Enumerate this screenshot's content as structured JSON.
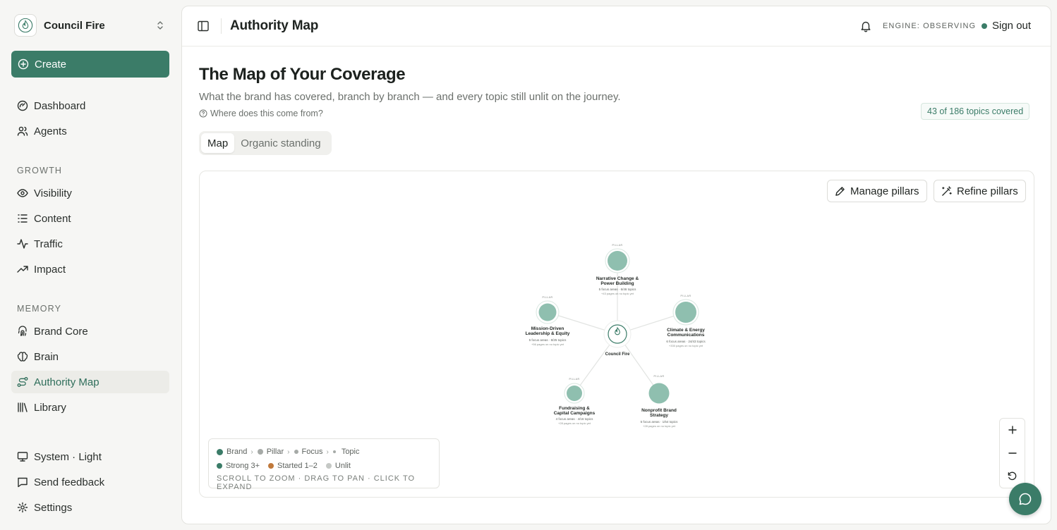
{
  "org": {
    "name": "Council Fire"
  },
  "sidebar": {
    "create_label": "Create",
    "top_items": [
      {
        "label": "Dashboard",
        "icon": "dashboard-icon"
      },
      {
        "label": "Agents",
        "icon": "users-icon"
      }
    ],
    "growth": {
      "title": "GROWTH",
      "items": [
        {
          "label": "Visibility",
          "icon": "eye-icon"
        },
        {
          "label": "Content",
          "icon": "list-icon"
        },
        {
          "label": "Traffic",
          "icon": "activity-icon"
        },
        {
          "label": "Impact",
          "icon": "trending-up-icon"
        }
      ]
    },
    "memory": {
      "title": "MEMORY",
      "items": [
        {
          "label": "Brand Core",
          "icon": "fingerprint-icon"
        },
        {
          "label": "Brain",
          "icon": "brain-icon"
        },
        {
          "label": "Authority Map",
          "icon": "route-icon",
          "active": true
        },
        {
          "label": "Library",
          "icon": "library-icon"
        }
      ]
    },
    "bottom_items": [
      {
        "label": "System · Light",
        "icon": "monitor-icon"
      },
      {
        "label": "Send feedback",
        "icon": "message-icon"
      },
      {
        "label": "Settings",
        "icon": "gear-icon"
      }
    ]
  },
  "header": {
    "title": "Authority Map",
    "engine_status": "ENGINE: OBSERVING",
    "sign_out": "Sign out"
  },
  "page": {
    "title": "The Map of Your Coverage",
    "subtitle": "What the brand has covered, branch by branch — and every topic still unlit on the journey.",
    "source_link": "Where does this come from?",
    "coverage_badge": "43 of 186 topics covered",
    "tabs": [
      "Map",
      "Organic standing"
    ],
    "active_tab": 0
  },
  "map": {
    "toolbar": {
      "manage_pillars": "Manage pillars",
      "refine_pillars": "Refine pillars"
    },
    "brand": {
      "label": "Council Fire"
    },
    "pillars": [
      {
        "tag": "PILLAR",
        "title": [
          "Narrative Change &",
          "Power Building"
        ],
        "stats": "5 focus areas · 6/46 topics",
        "note": "+43 pages on no topic yet"
      },
      {
        "tag": "PILLAR",
        "title": [
          "Mission-Driven",
          "Leadership & Equity"
        ],
        "stats": "5 focus areas · 8/25 topics",
        "note": "+56 pages on no topic yet"
      },
      {
        "tag": "PILLAR",
        "title": [
          "Climate & Energy",
          "Communications"
        ],
        "stats": "6 focus areas · 24/43 topics",
        "note": "+330 pages on no topic yet"
      },
      {
        "tag": "PILLAR",
        "title": [
          "Fundraising &",
          "Capital Campaigns"
        ],
        "stats": "4 focus areas · 4/16 topics",
        "note": "+28 pages on no topic yet"
      },
      {
        "tag": "PILLAR",
        "title": [
          "Nonprofit Brand",
          "Strategy"
        ],
        "stats": "5 focus areas · 1/54 topics",
        "note": "+28 pages on no topic yet"
      }
    ],
    "legend": {
      "row1": [
        "Brand",
        "Pillar",
        "Focus",
        "Topic"
      ],
      "row2": [
        "Strong 3+",
        "Started 1–2",
        "Unlit"
      ],
      "hint": "SCROLL TO ZOOM · DRAG TO PAN · CLICK TO EXPAND"
    },
    "colors": {
      "brand": "#3b7c68",
      "pillar": "#8fbfaf",
      "strong": "#3b7c68",
      "started": "#c0793b",
      "unlit": "#b8bcb8"
    }
  }
}
